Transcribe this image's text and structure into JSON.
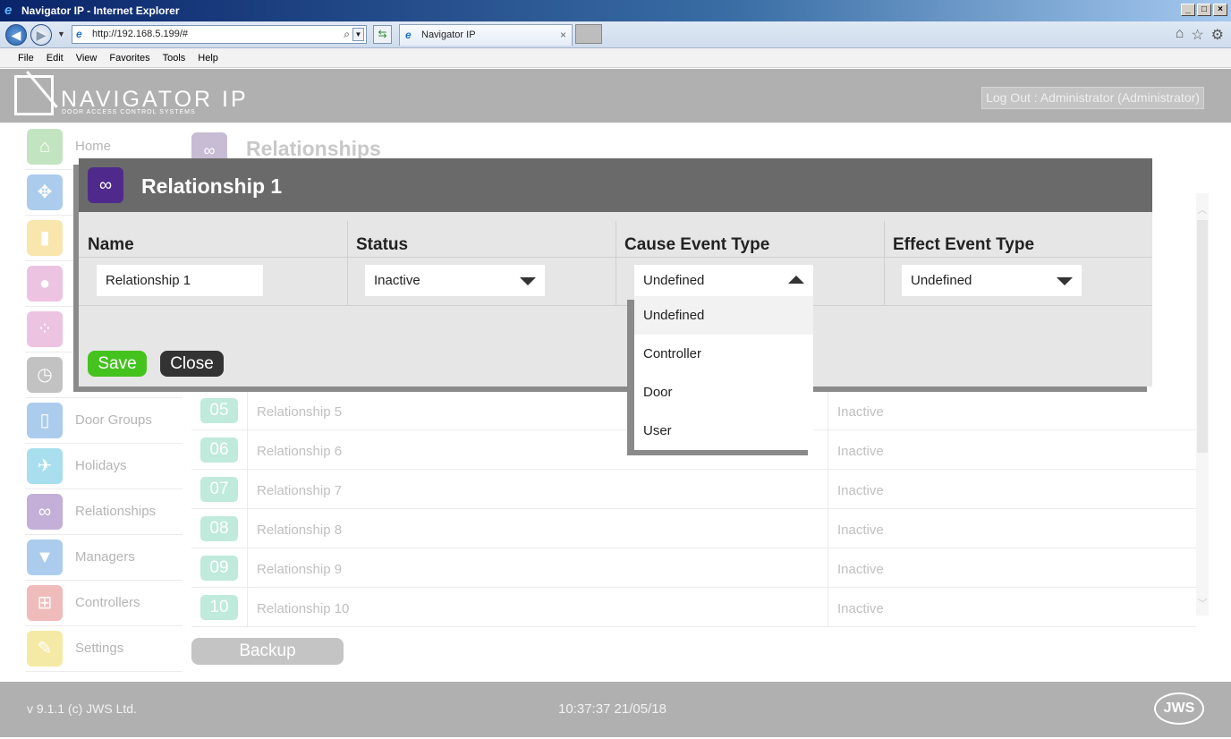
{
  "window": {
    "title": "Navigator IP - Internet Explorer",
    "url": "http://192.168.5.199/#",
    "tab_title": "Navigator IP",
    "menu": [
      "File",
      "Edit",
      "View",
      "Favorites",
      "Tools",
      "Help"
    ]
  },
  "app": {
    "logo_title": "NAVIGATOR IP",
    "logo_subtitle": "DOOR ACCESS CONTROL SYSTEMS",
    "logout_label": "Log Out : Administrator (Administrator)"
  },
  "sidebar": {
    "items": [
      {
        "label": "Home",
        "icon": "home-icon",
        "color": "#7cc576"
      },
      {
        "label": "",
        "icon": "grid-icon",
        "color": "#4a90d9"
      },
      {
        "label": "",
        "icon": "bar-chart-icon",
        "color": "#f2c94c"
      },
      {
        "label": "",
        "icon": "user-icon",
        "color": "#d67bbd"
      },
      {
        "label": "",
        "icon": "group-icon",
        "color": "#d67bbd"
      },
      {
        "label": "",
        "icon": "clock-icon",
        "color": "#7a7a7a"
      },
      {
        "label": "Door Groups",
        "icon": "door-icon",
        "color": "#4a90d9"
      },
      {
        "label": "Holidays",
        "icon": "plane-icon",
        "color": "#3fb8d8"
      },
      {
        "label": "Relationships",
        "icon": "link-icon",
        "color": "#7b4fa8"
      },
      {
        "label": "Managers",
        "icon": "tie-icon",
        "color": "#4a90d9"
      },
      {
        "label": "Controllers",
        "icon": "network-icon",
        "color": "#e06a6a"
      },
      {
        "label": "Settings",
        "icon": "wrench-icon",
        "color": "#e8d23a"
      }
    ]
  },
  "page": {
    "title": "Relationships",
    "rows": [
      {
        "num": "05",
        "name": "Relationship 5",
        "status": "Inactive"
      },
      {
        "num": "06",
        "name": "Relationship 6",
        "status": "Inactive"
      },
      {
        "num": "07",
        "name": "Relationship 7",
        "status": "Inactive"
      },
      {
        "num": "08",
        "name": "Relationship 8",
        "status": "Inactive"
      },
      {
        "num": "09",
        "name": "Relationship 9",
        "status": "Inactive"
      },
      {
        "num": "10",
        "name": "Relationship 10",
        "status": "Inactive"
      }
    ],
    "backup_label": "Backup"
  },
  "modal": {
    "title": "Relationship 1",
    "headers": {
      "name": "Name",
      "status": "Status",
      "cause": "Cause Event Type",
      "effect": "Effect Event Type"
    },
    "values": {
      "name": "Relationship 1",
      "status": "Inactive",
      "cause": "Undefined",
      "effect": "Undefined"
    },
    "cause_options": [
      "Undefined",
      "Controller",
      "Door",
      "User"
    ],
    "save_label": "Save",
    "close_label": "Close"
  },
  "footer": {
    "version": "v 9.1.1 (c) JWS Ltd.",
    "clock": "10:37:37 21/05/18",
    "brand": "JWS"
  }
}
